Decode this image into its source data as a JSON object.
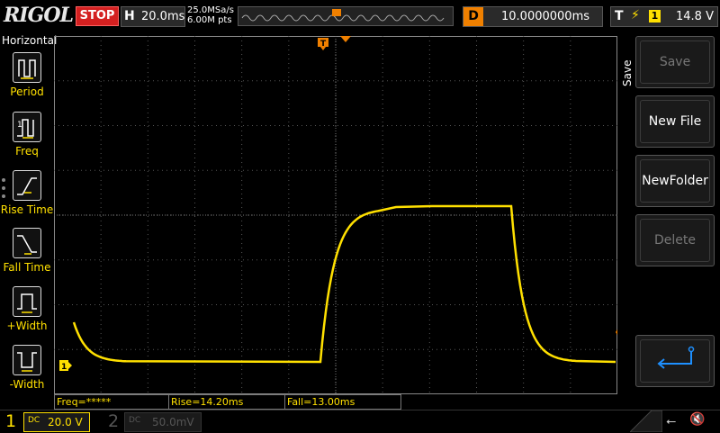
{
  "top": {
    "brand": "RIGOL",
    "run_state": "STOP",
    "horizontal_key": "H",
    "timebase": "20.0ms",
    "sample_rate": "25.0MSa/s",
    "memory_depth": "6.00M pts",
    "delay_key": "D",
    "delay": "10.0000000ms",
    "trigger_key": "T",
    "trigger_source": "1",
    "trigger_level": "14.8 V",
    "trigger_edge_icon": "rising-edge-icon"
  },
  "left_panel": {
    "title": "Horizontal",
    "items": [
      {
        "label": "Period",
        "icon": "period-icon"
      },
      {
        "label": "Freq",
        "icon": "freq-icon"
      },
      {
        "label": "Rise Time",
        "icon": "rise-time-icon"
      },
      {
        "label": "Fall Time",
        "icon": "fall-time-icon"
      },
      {
        "label": "+Width",
        "icon": "plus-width-icon"
      },
      {
        "label": "-Width",
        "icon": "minus-width-icon"
      }
    ]
  },
  "markers": {
    "trigger_top": "T",
    "ch1_ground": "1"
  },
  "right_panel": {
    "title": "Save",
    "buttons": [
      {
        "label": "Save",
        "enabled": false
      },
      {
        "label": "New File",
        "enabled": true
      },
      {
        "label": "NewFolder",
        "enabled": true
      },
      {
        "label": "Delete",
        "enabled": false
      },
      {
        "label": "",
        "icon": "enter-arrow-icon",
        "enabled": true
      }
    ]
  },
  "measurements": {
    "freq": "Freq=*****",
    "rise": "Rise=14.20ms",
    "fall": "Fall=13.00ms"
  },
  "channels": {
    "ch1": {
      "number": "1",
      "coupling": "DC",
      "scale": "20.0 V",
      "color": "#ffe000"
    },
    "ch2": {
      "number": "2",
      "coupling": "DC",
      "scale": "50.0mV",
      "color": "#555555"
    }
  },
  "colors": {
    "trace": "#ffe000",
    "trigger": "#f08000",
    "stop": "#d42020",
    "accent": "#1e90ff"
  }
}
